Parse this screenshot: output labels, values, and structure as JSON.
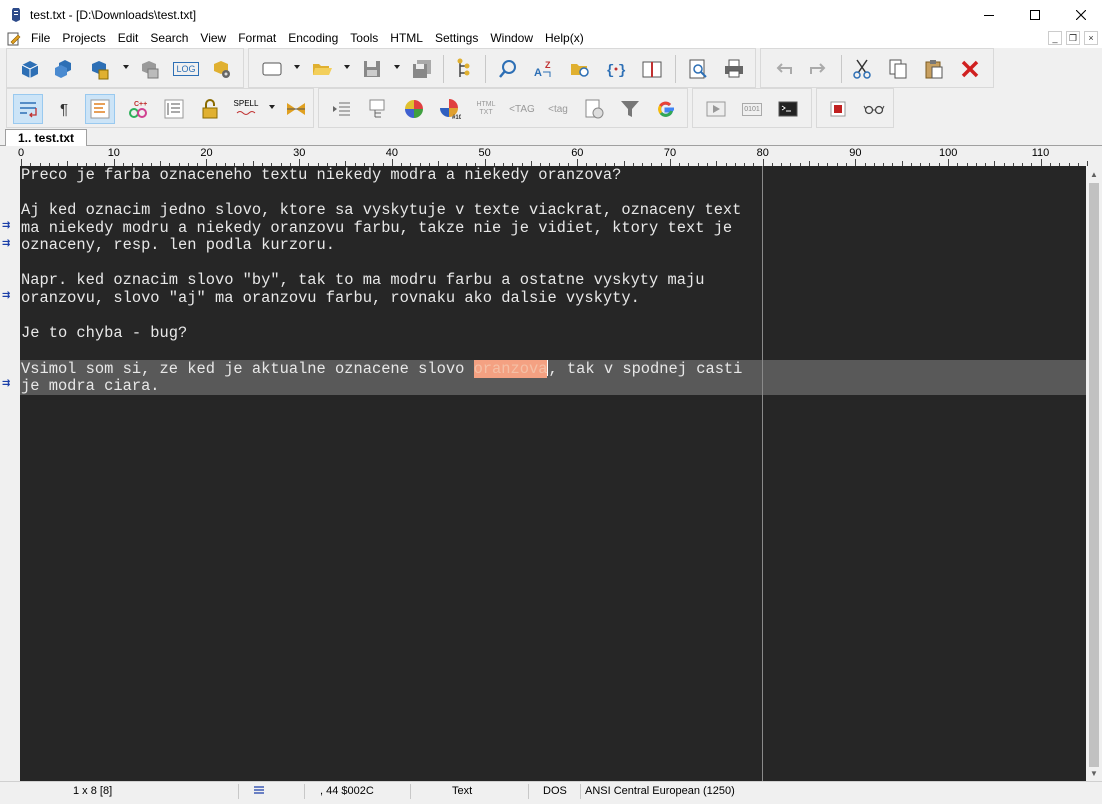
{
  "window": {
    "title": "test.txt - [D:\\Downloads\\test.txt]"
  },
  "menu": [
    "File",
    "Projects",
    "Edit",
    "Search",
    "View",
    "Format",
    "Encoding",
    "Tools",
    "HTML",
    "Settings",
    "Window",
    "Help(x)"
  ],
  "toolbar": {
    "log_label": "LOG",
    "spell_label": "SPELL",
    "html_label": "HTML",
    "txt_label": "TXT",
    "tag_close_label": "<TAG",
    "tag_open_label": "<tag",
    "binary_label": "0101"
  },
  "tab": {
    "label": "1.. test.txt"
  },
  "ruler": [
    "0",
    "10",
    "20",
    "30",
    "40",
    "50",
    "60",
    "70",
    "80",
    "90",
    "100",
    "110"
  ],
  "editor": {
    "lines": [
      "Preco je farba oznaceneho textu niekedy modra a niekedy oranzova?",
      "",
      "Aj ked oznacim jedno slovo, ktore sa vyskytuje v texte viackrat, oznaceny text",
      "ma niekedy modru a niekedy oranzovu farbu, takze nie je vidiet, ktory text je",
      "oznaceny, resp. len podla kurzoru.",
      "",
      "Napr. ked oznacim slovo \"by\", tak to ma modru farbu a ostatne vyskyty maju",
      "oranzovu, slovo \"aj\" ma oranzovu farbu, rovnaku ako dalsie vyskyty.",
      "",
      "Je to chyba - bug?",
      "",
      "",
      "je modra ciara."
    ],
    "line11_before": "Vsimol som si, ze ked je aktualne oznacene slovo ",
    "line11_selected": "oranzova",
    "line11_after": ", tak v spodnej casti"
  },
  "status": {
    "position": "1 x 8  [8]",
    "char_info": ",  44  $002C",
    "mode": "Text",
    "line_endings": "DOS",
    "encoding": "ANSI Central European (1250)"
  },
  "colors": {
    "editor_bg": "#262626",
    "current_line_bg": "#595959",
    "selection_bg": "#f4a182"
  }
}
